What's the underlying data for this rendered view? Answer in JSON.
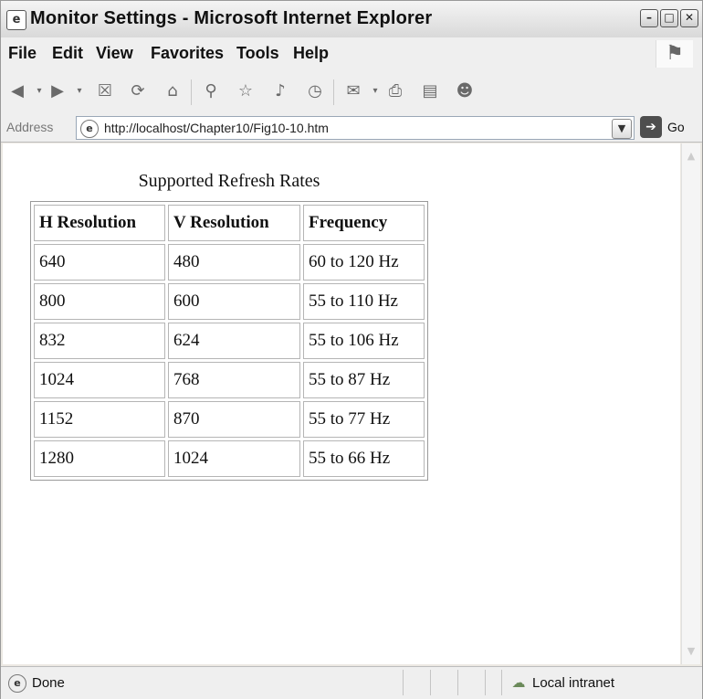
{
  "window": {
    "title": "Monitor Settings - Microsoft Internet Explorer",
    "controls": [
      "minimize",
      "maximize",
      "close"
    ]
  },
  "menu": {
    "items": [
      "File",
      "Edit",
      "View",
      "Favorites",
      "Tools",
      "Help"
    ]
  },
  "toolbar": {
    "icons": [
      "back-icon",
      "forward-icon",
      "stop-icon",
      "refresh-icon",
      "home-icon",
      "search-icon",
      "favorites-icon",
      "media-icon",
      "history-icon",
      "mail-icon",
      "print-icon",
      "edit-icon",
      "messenger-icon"
    ]
  },
  "address": {
    "label": "Address",
    "url": "http://localhost/Chapter10/Fig10-10.htm",
    "go_label": "Go"
  },
  "page": {
    "caption": "Supported Refresh Rates",
    "headers": [
      "H Resolution",
      "V Resolution",
      "Frequency"
    ],
    "rows": [
      [
        "640",
        "480",
        "60 to 120 Hz"
      ],
      [
        "800",
        "600",
        "55 to 110 Hz"
      ],
      [
        "832",
        "624",
        "55 to 106 Hz"
      ],
      [
        "1024",
        "768",
        "55 to 87 Hz"
      ],
      [
        "1152",
        "870",
        "55 to 77 Hz"
      ],
      [
        "1280",
        "1024",
        "55 to 66 Hz"
      ]
    ]
  },
  "status": {
    "text": "Done",
    "zone": "Local intranet"
  }
}
